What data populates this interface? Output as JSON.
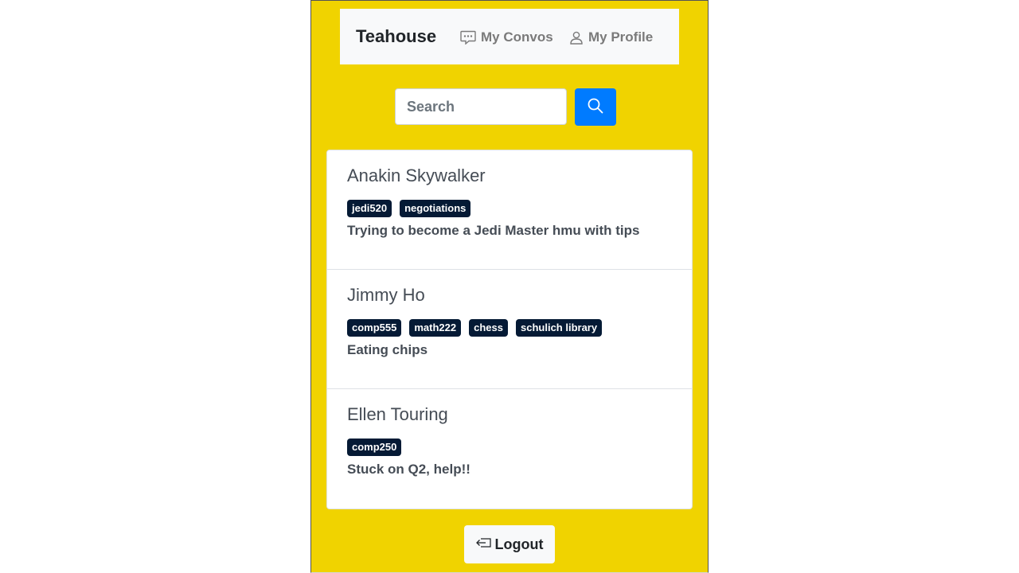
{
  "navbar": {
    "brand": "Teahouse",
    "links": [
      {
        "label": "My Convos",
        "icon": "chat-icon"
      },
      {
        "label": "My Profile",
        "icon": "person-icon"
      }
    ]
  },
  "search": {
    "placeholder": "Search",
    "value": "",
    "button_icon": "search-icon"
  },
  "users": [
    {
      "name": "Anakin Skywalker",
      "tags": [
        "jedi520",
        "negotiations"
      ],
      "bio": "Trying to become a Jedi Master hmu with tips"
    },
    {
      "name": "Jimmy Ho",
      "tags": [
        "comp555",
        "math222",
        "chess",
        "schulich library"
      ],
      "bio": "Eating chips"
    },
    {
      "name": "Ellen Touring",
      "tags": [
        "comp250"
      ],
      "bio": "Stuck on Q2, help!!"
    }
  ],
  "logout": {
    "label": "Logout",
    "icon": "logout-icon"
  },
  "colors": {
    "background": "#f0d300",
    "primary": "#007bff",
    "tag": "#051a35"
  }
}
